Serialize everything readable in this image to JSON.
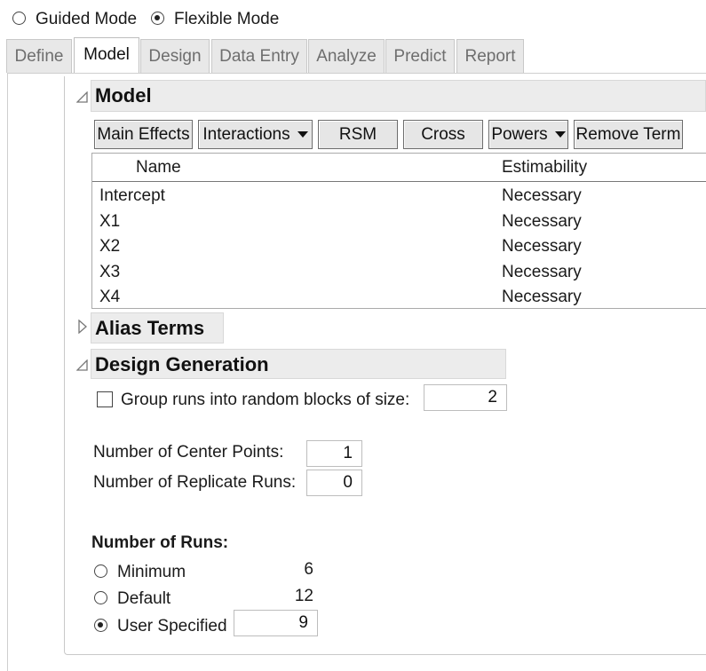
{
  "mode": {
    "guided_label": "Guided Mode",
    "flexible_label": "Flexible Mode",
    "selected": "Flexible Mode"
  },
  "tabs": [
    {
      "label": "Define",
      "active": false
    },
    {
      "label": "Model",
      "active": true
    },
    {
      "label": "Design",
      "active": false
    },
    {
      "label": "Data Entry",
      "active": false
    },
    {
      "label": "Analyze",
      "active": false
    },
    {
      "label": "Predict",
      "active": false
    },
    {
      "label": "Report",
      "active": false
    }
  ],
  "model_section": {
    "title": "Model",
    "buttons": {
      "main_effects": "Main Effects",
      "interactions": "Interactions",
      "rsm": "RSM",
      "cross": "Cross",
      "powers": "Powers",
      "remove_term": "Remove Term"
    },
    "table": {
      "columns": [
        "Name",
        "Estimability"
      ],
      "rows": [
        {
          "name": "Intercept",
          "estimability": "Necessary"
        },
        {
          "name": "X1",
          "estimability": "Necessary"
        },
        {
          "name": "X2",
          "estimability": "Necessary"
        },
        {
          "name": "X3",
          "estimability": "Necessary"
        },
        {
          "name": "X4",
          "estimability": "Necessary"
        }
      ]
    }
  },
  "alias_section": {
    "title": "Alias Terms",
    "expanded": false
  },
  "design_generation": {
    "title": "Design Generation",
    "group_runs_label": "Group runs into random blocks of size:",
    "group_runs_checked": false,
    "block_size": "2",
    "center_points_label": "Number of Center Points:",
    "center_points": "1",
    "replicate_runs_label": "Number of Replicate Runs:",
    "replicate_runs": "0",
    "runs_heading": "Number of Runs:",
    "runs_options": [
      {
        "label": "Minimum",
        "value": "6",
        "selected": false
      },
      {
        "label": "Default",
        "value": "12",
        "selected": false
      },
      {
        "label": "User Specified",
        "value": "9",
        "selected": true
      }
    ]
  }
}
